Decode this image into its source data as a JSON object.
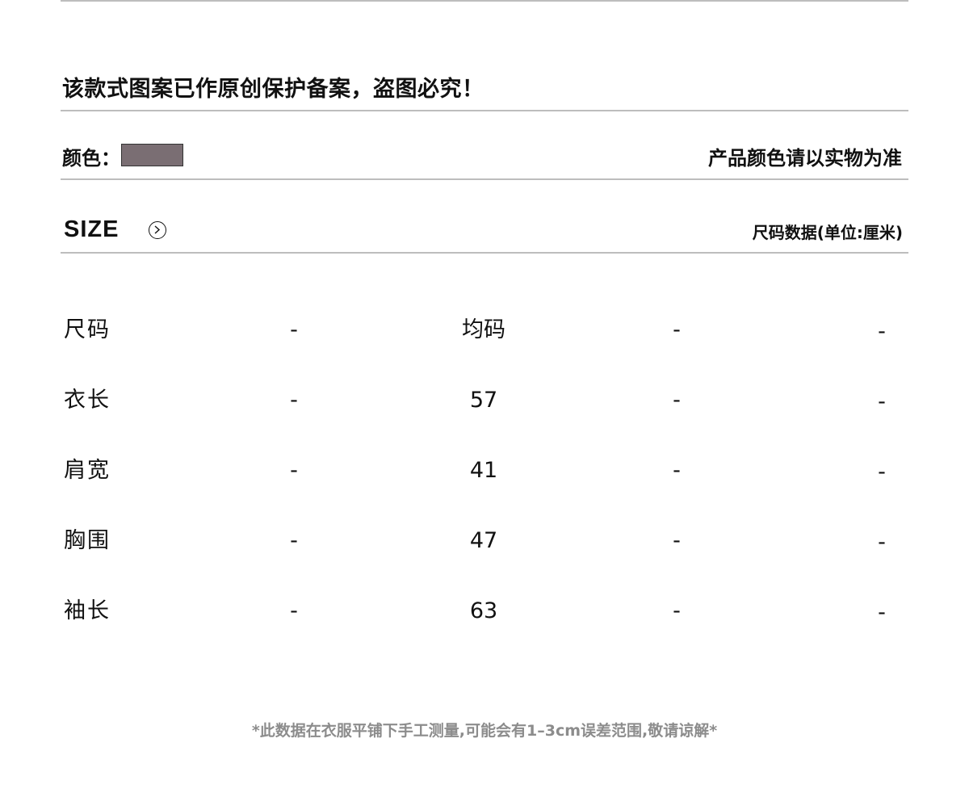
{
  "copyright_notice": "该款式图案已作原创保护备案，盗图必究！",
  "color": {
    "label": "颜色：",
    "swatch_color": "#7a6e73",
    "note": "产品颜色请以实物为准"
  },
  "size_header": {
    "title": "SIZE",
    "arrow_icon": "circle-chevron-right-icon",
    "unit_note": "尺码数据(单位:厘米)"
  },
  "size_table": {
    "rows": [
      {
        "label": "尺码",
        "c1": "-",
        "c2": "均码",
        "c3": "-",
        "c4": "-"
      },
      {
        "label": "衣长",
        "c1": "-",
        "c2": "57",
        "c3": "-",
        "c4": "-"
      },
      {
        "label": "肩宽",
        "c1": "-",
        "c2": "41",
        "c3": "-",
        "c4": "-"
      },
      {
        "label": "胸围",
        "c1": "-",
        "c2": "47",
        "c3": "-",
        "c4": "-"
      },
      {
        "label": "袖长",
        "c1": "-",
        "c2": "63",
        "c3": "-",
        "c4": "-"
      }
    ]
  },
  "footnote": "*此数据在衣服平铺下手工测量,可能会有1–3cm误差范围,敬请谅解*"
}
